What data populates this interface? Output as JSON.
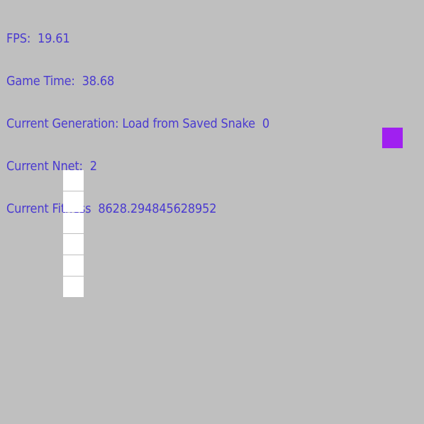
{
  "hud": {
    "fps_label": "FPS:",
    "fps_value": "19.61",
    "game_time_label": "Game Time:",
    "game_time_value": "38.68",
    "generation_label": "Current Generation: Load from Saved Snake",
    "generation_value": "0",
    "nnet_label": "Current Nnet:",
    "nnet_value": "2",
    "fitness_label": "Current Fitness",
    "fitness_value": "8628.294845628952"
  },
  "game": {
    "snake_segment_count": 6,
    "snake_color": "#ffffff",
    "food_color": "#a020f0",
    "background_color": "#bfbfbf",
    "text_color": "#4a3ad0"
  }
}
